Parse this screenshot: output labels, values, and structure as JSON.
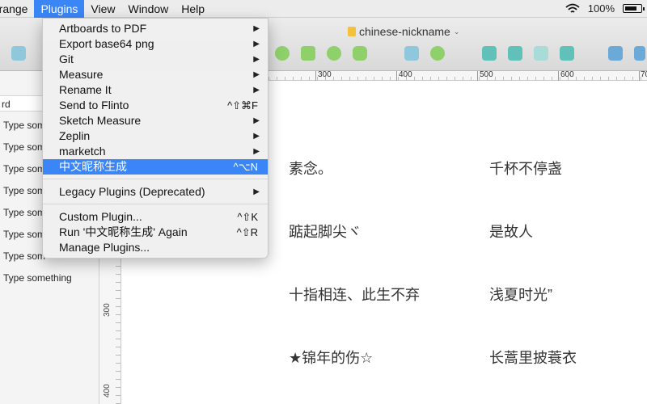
{
  "menubar": {
    "items": [
      "rrange",
      "Plugins",
      "View",
      "Window",
      "Help"
    ],
    "battery": "100%"
  },
  "toolbar": {
    "doc_title": "chinese-nickname"
  },
  "plugins_menu": {
    "items": [
      {
        "label": "Artboards to PDF",
        "shortcut": "",
        "submenu": true
      },
      {
        "label": "Export base64 png",
        "shortcut": "",
        "submenu": true
      },
      {
        "label": "Git",
        "shortcut": "",
        "submenu": true
      },
      {
        "label": "Measure",
        "shortcut": "",
        "submenu": true
      },
      {
        "label": "Rename It",
        "shortcut": "",
        "submenu": true
      },
      {
        "label": "Send to Flinto",
        "shortcut": "^⇧⌘F",
        "submenu": false
      },
      {
        "label": "Sketch Measure",
        "shortcut": "",
        "submenu": true
      },
      {
        "label": "Zeplin",
        "shortcut": "",
        "submenu": true
      },
      {
        "label": "marketch",
        "shortcut": "",
        "submenu": true
      },
      {
        "label": "中文昵称生成",
        "shortcut": "^⌥N",
        "submenu": false
      },
      {
        "label": "Legacy Plugins (Deprecated)",
        "shortcut": "",
        "submenu": true
      },
      {
        "label": "Custom Plugin...",
        "shortcut": "^⇧K",
        "submenu": false
      },
      {
        "label": "Run '中文昵称生成' Again",
        "shortcut": "^⇧R",
        "submenu": false
      },
      {
        "label": "Manage Plugins...",
        "shortcut": "",
        "submenu": false
      }
    ]
  },
  "layers": {
    "search_value": "rd",
    "rows": [
      "Type som",
      "Type som",
      "Type som",
      "Type som",
      "Type som",
      "Type som",
      "Type som",
      "Type something"
    ]
  },
  "hruler": {
    "labels": [
      "300",
      "400",
      "500",
      "600",
      "70"
    ]
  },
  "vruler": {
    "labels": [
      "300",
      "400"
    ]
  },
  "canvas": {
    "nicknames": [
      "素念。",
      "千杯不停盏",
      "踮起脚尖ヾ",
      "是故人",
      "十指相连、此生不弃",
      "浅夏时光”",
      "★锦年的伤☆",
      "长蒿里披蓑衣"
    ]
  },
  "colors": {
    "highlight": "#3b86f7",
    "menubar_bg": "#ececec"
  }
}
